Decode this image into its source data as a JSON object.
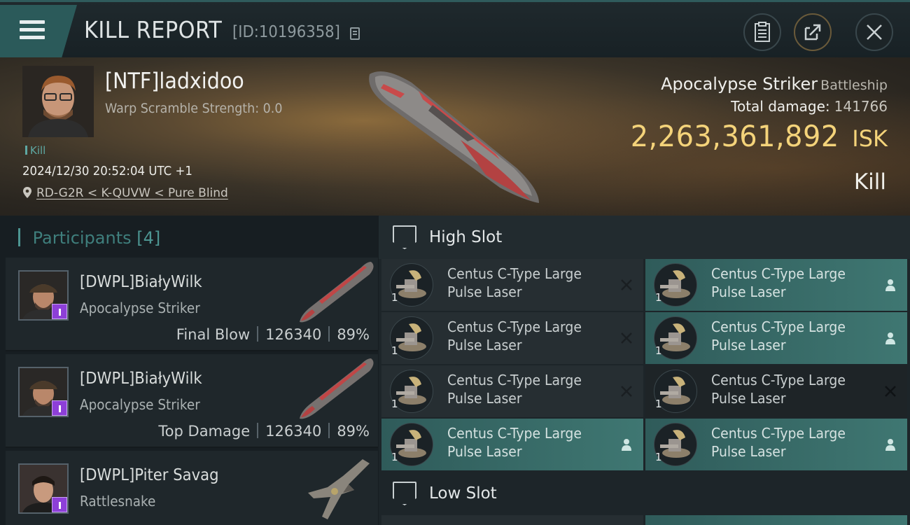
{
  "header": {
    "title": "KILL REPORT",
    "report_id": "[ID:10196358]",
    "icons": [
      "menu-icon",
      "copy-icon",
      "clipboard-icon",
      "share-icon",
      "close-icon"
    ]
  },
  "victim": {
    "name": "[NTF]ladxidoo",
    "warp_scramble": "Warp Scramble Strength: 0.0",
    "tag": "Kill",
    "time": "2024/12/30 20:52:04 UTC +1",
    "location": "RD-G2R < K-QUVW < Pure Blind",
    "ship_name": "Apocalypse Striker",
    "ship_class": "Battleship",
    "total_damage_label": "Total damage:",
    "total_damage": "141766",
    "isk_value": "2,263,361,892",
    "isk_unit": "ISK",
    "result": "Kill"
  },
  "participants": {
    "label": "Participants",
    "count": "[4]",
    "items": [
      {
        "name": "[DWPL]BiałyWilk",
        "ship": "Apocalypse Striker",
        "role": "Final Blow",
        "damage": "126340",
        "percent": "89%"
      },
      {
        "name": "[DWPL]BiałyWilk",
        "ship": "Apocalypse Striker",
        "role": "Top Damage",
        "damage": "126340",
        "percent": "89%"
      },
      {
        "name": "[DWPL]Piter Savag",
        "ship": "Rattlesnake",
        "role": "",
        "damage": "",
        "percent": ""
      }
    ]
  },
  "fitting": {
    "high_slot": {
      "title": "High Slot",
      "modules": [
        {
          "name_line1": "Centus C-Type Large",
          "name_line2": "Pulse Laser",
          "qty": "1",
          "status": "destroyed"
        },
        {
          "name_line1": "Centus C-Type Large",
          "name_line2": "Pulse Laser",
          "qty": "1",
          "status": "dropped"
        },
        {
          "name_line1": "Centus C-Type Large",
          "name_line2": "Pulse Laser",
          "qty": "1",
          "status": "destroyed"
        },
        {
          "name_line1": "Centus C-Type Large",
          "name_line2": "Pulse Laser",
          "qty": "1",
          "status": "dropped"
        },
        {
          "name_line1": "Centus C-Type Large",
          "name_line2": "Pulse Laser",
          "qty": "1",
          "status": "destroyed"
        },
        {
          "name_line1": "Centus C-Type Large",
          "name_line2": "Pulse Laser",
          "qty": "1",
          "status": "destroyed"
        },
        {
          "name_line1": "Centus C-Type Large",
          "name_line2": "Pulse Laser",
          "qty": "1",
          "status": "dropped"
        },
        {
          "name_line1": "Centus C-Type Large",
          "name_line2": "Pulse Laser",
          "qty": "1",
          "status": "dropped"
        }
      ]
    },
    "low_slot": {
      "title": "Low Slot"
    }
  },
  "colors": {
    "accent_teal": "#3f7772",
    "isk_gold": "#f4d37a",
    "badge_purple": "#8d3fd8"
  }
}
